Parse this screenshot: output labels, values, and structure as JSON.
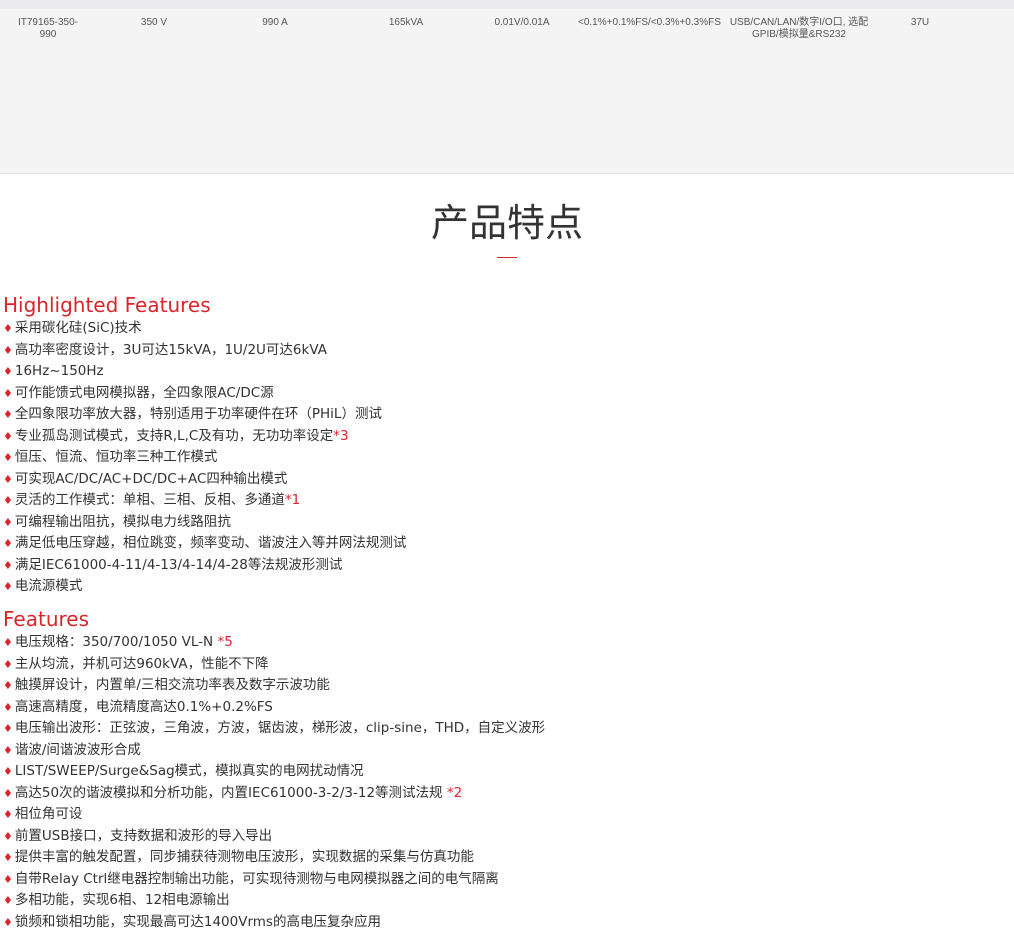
{
  "spec_table": {
    "row": {
      "model": "IT79165-350-990",
      "voltage": "350 V",
      "current": "990 A",
      "power": "165kVA",
      "resolution": "0.01V/0.01A",
      "accuracy": "<0.1%+0.1%FS/<0.3%+0.3%FS",
      "interfaces": "USB/CAN/LAN/数字I/O口, 选配GPIB/模拟量&RS232",
      "height": "37U"
    }
  },
  "section": {
    "title": "产品特点"
  },
  "highlighted": {
    "heading": "Highlighted Features",
    "items": [
      {
        "text": "采用碳化硅(SiC)技术",
        "note": ""
      },
      {
        "text": "高功率密度设计，3U可达15kVA，1U/2U可达6kVA",
        "note": ""
      },
      {
        "text": "16Hz~150Hz",
        "note": ""
      },
      {
        "text": "可作能馈式电网模拟器，全四象限AC/DC源",
        "note": ""
      },
      {
        "text": "全四象限功率放大器，特别适用于功率硬件在环（PHiL）测试",
        "note": ""
      },
      {
        "text": "专业孤岛测试模式，支持R,L,C及有功，无功功率设定",
        "note": "*3"
      },
      {
        "text": "恒压、恒流、恒功率三种工作模式",
        "note": ""
      },
      {
        "text": "可实现AC/DC/AC+DC/DC+AC四种输出模式",
        "note": ""
      },
      {
        "text": "灵活的工作模式：单相、三相、反相、多通道",
        "note": "*1"
      },
      {
        "text": "可编程输出阻抗，模拟电力线路阻抗",
        "note": ""
      },
      {
        "text": "满足低电压穿越，相位跳变，频率变动、谐波注入等并网法规测试",
        "note": ""
      },
      {
        "text": "满足IEC61000-4-11/4-13/4-14/4-28等法规波形测试",
        "note": ""
      },
      {
        "text": "电流源模式",
        "note": ""
      }
    ]
  },
  "features": {
    "heading": "Features",
    "items": [
      {
        "text": "电压规格：350/700/1050 VL-N ",
        "note": "*5"
      },
      {
        "text": "主从均流，并机可达960kVA，性能不下降",
        "note": ""
      },
      {
        "text": "触摸屏设计，内置单/三相交流功率表及数字示波功能",
        "note": ""
      },
      {
        "text": "高速高精度，电流精度高达0.1%+0.2%FS",
        "note": ""
      },
      {
        "text": "电压输出波形：正弦波，三角波，方波，锯齿波，梯形波，clip-sine，THD，自定义波形",
        "note": ""
      },
      {
        "text": "谐波/间谐波波形合成",
        "note": ""
      },
      {
        "text": "LIST/SWEEP/Surge&Sag模式，模拟真实的电网扰动情况",
        "note": ""
      },
      {
        "text": "高达50次的谐波模拟和分析功能，内置IEC61000-3-2/3-12等测试法规 ",
        "note": "*2"
      },
      {
        "text": "相位角可设",
        "note": ""
      },
      {
        "text": "前置USB接口，支持数据和波形的导入导出",
        "note": ""
      },
      {
        "text": "提供丰富的触发配置，同步捕获待测物电压波形，实现数据的采集与仿真功能",
        "note": ""
      },
      {
        "text": "自带Relay Ctrl继电器控制输出功能，可实现待测物与电网模拟器之间的电气隔离",
        "note": ""
      },
      {
        "text": "多相功能，实现6相、12相电源输出",
        "note": ""
      },
      {
        "text": "锁频和锁相功能，实现最高可达1400Vrms的高电压复杂应用",
        "note": ""
      }
    ]
  },
  "colors": {
    "accent": "#d9262c",
    "panel_bg": "#f4f4f5"
  }
}
